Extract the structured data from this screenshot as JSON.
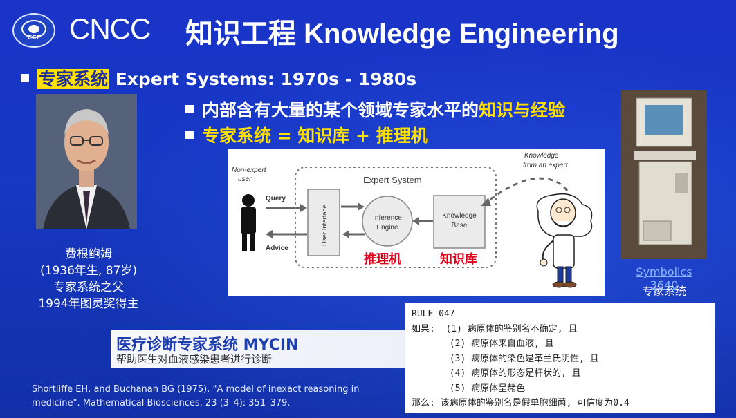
{
  "header": {
    "logo_ccf_text": "CCF",
    "logo_cncc": "CNCC",
    "title": "知识工程 Knowledge Engineering"
  },
  "bullets": {
    "b1_highlight": "专家系统",
    "b1_rest": " Expert Systems: 1970s - 1980s",
    "b2_plain": "内部含有大量的某个领域专家水平的",
    "b2_highlight": "知识与经验",
    "b3": "专家系统 = 知识库 + 推理机"
  },
  "portrait_caption": [
    "费根鲍姆",
    "(1936年生, 87岁)",
    "专家系统之父",
    "1994年图灵奖得主"
  ],
  "diagram": {
    "non_expert": "Non-expert",
    "user": "user",
    "query": "Query",
    "advice": "Advice",
    "expert_system": "Expert System",
    "user_interface": "User Interface",
    "inference": "Inference",
    "engine": "Engine",
    "knowledge": "Knowledge",
    "base": "Base",
    "knowledge_from": "Knowledge",
    "from_expert": "from an expert",
    "label_inference_cn": "推理机",
    "label_kb_cn": "知识库"
  },
  "symbolics": {
    "link": "Symbolics 3640",
    "caption": "专家系统"
  },
  "mycin": {
    "title": "医疗诊断专家系统 MYCIN",
    "subtitle": "帮助医生对血液感染患者进行诊断"
  },
  "citation": "Shortliffe EH, and Buchanan BG (1975). \"A model of inexact reasoning in medicine\". Mathematical Biosciences. 23 (3–4): 351–379.",
  "rule": {
    "lines": [
      "RULE 047",
      "如果:  (1) 病原体的鉴别名不确定, 且",
      "       (2) 病原体来自血液, 且",
      "       (3) 病原体的染色是革兰氏阴性, 且",
      "       (4) 病原体的形态是杆状的, 且",
      "       (5) 病原体呈赭色",
      "那么: 该病原体的鉴别名是假单胞细菌, 可信度为0.4"
    ]
  },
  "colors": {
    "background": "#1638c4",
    "highlight_yellow": "#ffe000",
    "label_red": "#e0001a"
  }
}
